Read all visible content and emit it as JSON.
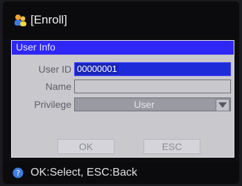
{
  "title": {
    "text": "[Enroll]",
    "icon": "users-icon"
  },
  "dialog": {
    "header": "User Info",
    "fields": {
      "user_id_label": "User ID",
      "user_id_value": "00000001",
      "name_label": "Name",
      "name_value": "",
      "privilege_label": "Privilege",
      "privilege_value": "User"
    },
    "buttons": {
      "ok": "OK",
      "esc": "ESC"
    }
  },
  "status": {
    "text": "OK:Select, ESC:Back",
    "icon": "help-icon"
  },
  "colors": {
    "header_blue": "#2f27f5",
    "dialog_bg": "#c8c8cd",
    "screen_bg": "#0d0d10"
  }
}
